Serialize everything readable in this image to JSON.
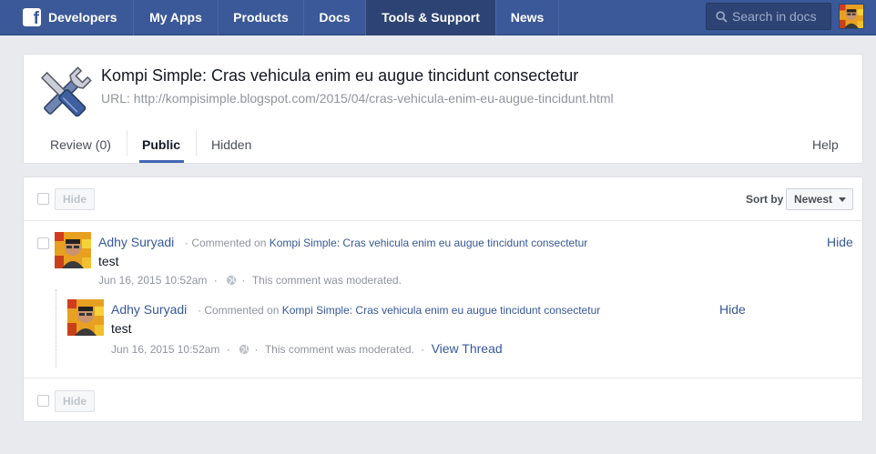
{
  "nav": {
    "brand": "Developers",
    "items": [
      "My Apps",
      "Products",
      "Docs",
      "Tools & Support",
      "News"
    ],
    "search_placeholder": "Search in docs"
  },
  "object": {
    "title": "Kompi Simple: Cras vehicula enim eu augue tincidunt consectetur",
    "url": "URL: http://kompisimple.blogspot.com/2015/04/cras-vehicula-enim-eu-augue-tincidunt.html"
  },
  "tabs": {
    "review": "Review (0)",
    "public": "Public",
    "hidden": "Hidden",
    "help": "Help"
  },
  "toolbar": {
    "hide_label": "Hide",
    "sort_label": "Sort by",
    "sort_value": "Newest"
  },
  "comments": [
    {
      "author": "Adhy Suryadi",
      "commented_on": "· Commented on",
      "target": "Kompi Simple: Cras vehicula enim eu augue tincidunt consectetur",
      "text": "test",
      "timestamp": "Jun 16, 2015 10:52am",
      "moderation": "This comment was moderated.",
      "hide_label": "Hide"
    },
    {
      "author": "Adhy Suryadi",
      "commented_on": "· Commented on",
      "target": "Kompi Simple: Cras vehicula enim eu augue tincidunt consectetur",
      "text": "test",
      "timestamp": "Jun 16, 2015 10:52am",
      "moderation": "This comment was moderated.",
      "view_thread": "View Thread",
      "hide_label": "Hide"
    }
  ],
  "colors": {
    "brand_blue": "#3b5998",
    "link_blue": "#365899",
    "active_tab": "#2d4373"
  }
}
